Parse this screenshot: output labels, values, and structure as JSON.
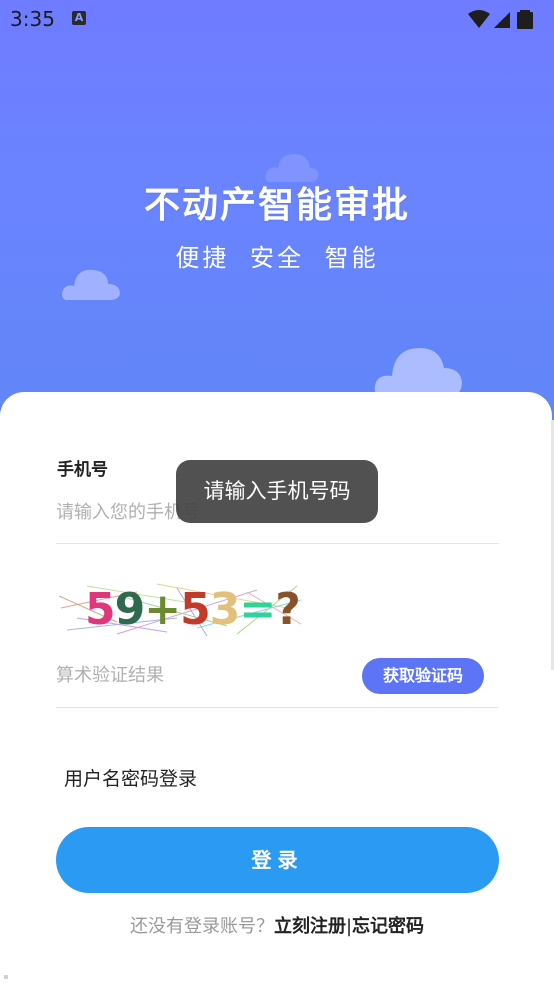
{
  "status_bar": {
    "time": "3:35",
    "notification_badge": "A",
    "icons": [
      "wifi-icon",
      "signal-icon",
      "battery-icon"
    ]
  },
  "hero": {
    "title": "不动产智能审批",
    "subtitle": "便捷 安全 智能"
  },
  "form": {
    "phone_label": "手机号",
    "phone_placeholder": "请输入您的手机号",
    "captcha_text": "59+53=?",
    "calc_placeholder": "算术验证结果",
    "get_code_label": "获取验证码",
    "alt_login_label": "用户名密码登录",
    "login_label": "登录"
  },
  "footer": {
    "question": "还没有登录账号？",
    "register_label": "立刻注册",
    "separator": "|",
    "forgot_label": "忘记密码"
  },
  "toast": {
    "message": "请输入手机号码"
  },
  "colors": {
    "hero_top": "#6f7cff",
    "hero_bottom": "#5f86f6",
    "get_code_button": "#5d74f6",
    "login_button": "#2b9af3"
  }
}
